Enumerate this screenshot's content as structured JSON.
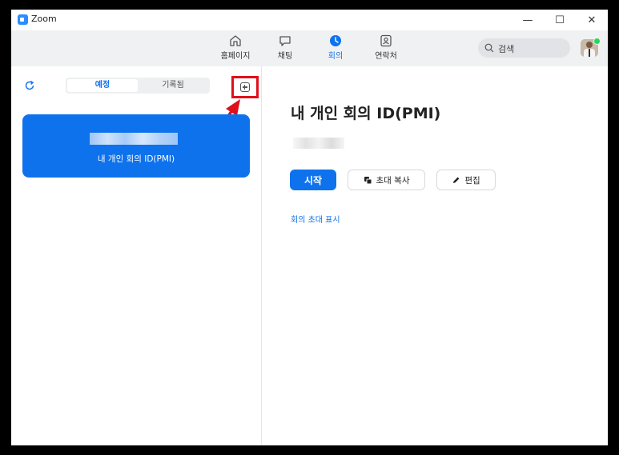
{
  "window": {
    "title": "Zoom"
  },
  "titlebar": {
    "minimize": "—",
    "maximize": "☐",
    "close": "✕"
  },
  "nav": {
    "items": [
      {
        "label": "홈페이지",
        "icon": "home-icon"
      },
      {
        "label": "채팅",
        "icon": "chat-icon"
      },
      {
        "label": "회의",
        "icon": "clock-icon",
        "active": true
      },
      {
        "label": "연락처",
        "icon": "contacts-icon"
      }
    ],
    "search_placeholder": "검색"
  },
  "left": {
    "tabs": [
      "예정",
      "기록됨"
    ],
    "selected_tab": "예정",
    "pmi_card_label": "내 개인 회의 ID(PMI)"
  },
  "right": {
    "title": "내 개인 회의 ID(PMI)",
    "start_label": "시작",
    "copy_invite_label": "초대 복사",
    "edit_label": "편집",
    "show_invite_link": "회의 초대 표시"
  },
  "colors": {
    "accent": "#0e72ed",
    "highlight": "#e0101b",
    "presence": "#23d959"
  }
}
